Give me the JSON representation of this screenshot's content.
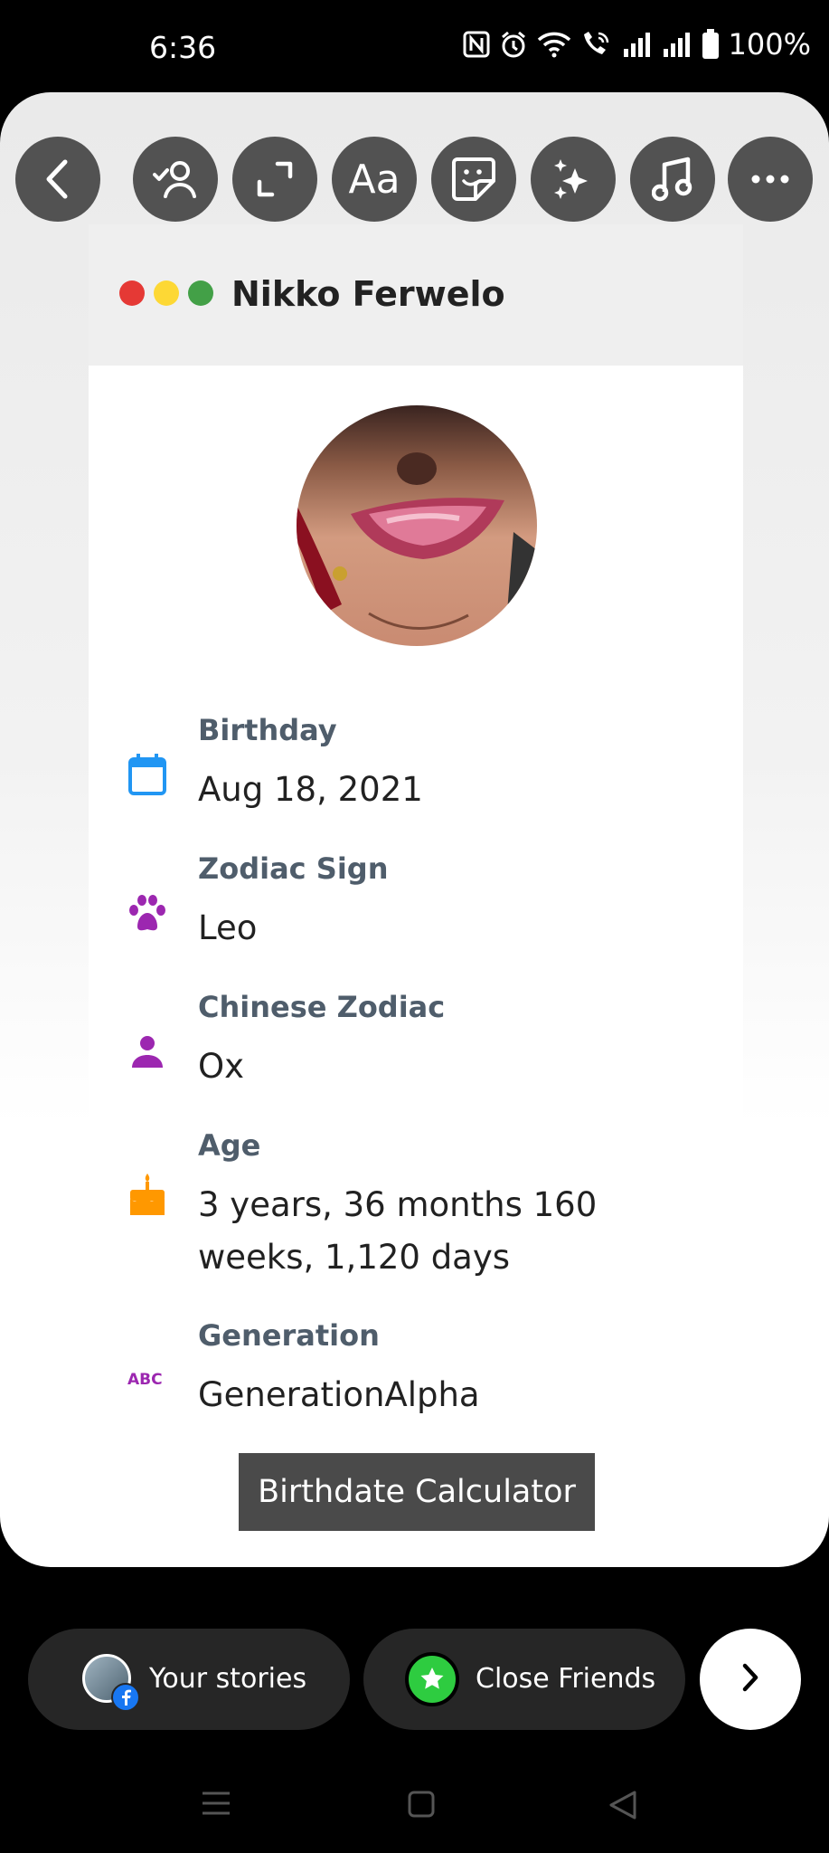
{
  "status_bar": {
    "time": "6:36",
    "battery": "100%",
    "icons": [
      "nfc-icon",
      "alarm-icon",
      "wifi-icon",
      "wifi-calling-icon",
      "signal-icon",
      "signal-icon",
      "battery-icon"
    ]
  },
  "toolbar": {
    "buttons": [
      "back-icon",
      "mention-icon",
      "resize-icon",
      "text-icon",
      "sticker-icon",
      "effects-icon",
      "music-icon",
      "more-icon"
    ],
    "text_tool_label": "Aa"
  },
  "card": {
    "title": "Nikko Ferwelo",
    "window_dots": [
      "#e53935",
      "#fdd835",
      "#43a047"
    ],
    "avatar": "profile-photo",
    "fields": [
      {
        "label": "Birthday",
        "value": "Aug 18, 2021",
        "icon": "calendar-icon",
        "color": "#2196f3"
      },
      {
        "label": "Zodiac Sign",
        "value": "Leo",
        "icon": "paw-icon",
        "color": "#9c27b0"
      },
      {
        "label": "Chinese Zodiac",
        "value": "Ox",
        "icon": "person-icon",
        "color": "#9c27b0"
      },
      {
        "label": "Age",
        "value": "3 years, 36 months 160 weeks, 1,120 days",
        "icon": "cake-icon",
        "color": "#ff9800"
      },
      {
        "label": "Generation",
        "value": "GenerationAlpha",
        "icon": "abc-icon",
        "color": "#9c27b0"
      }
    ],
    "button_label": "Birthdate Calculator"
  },
  "bottom": {
    "your_stories": "Your stories",
    "close_friends": "Close Friends",
    "close_friends_color": "#2ecc40",
    "next_icon": "chevron-right-icon"
  },
  "nav": [
    "menu-icon",
    "home-icon",
    "back-icon"
  ]
}
